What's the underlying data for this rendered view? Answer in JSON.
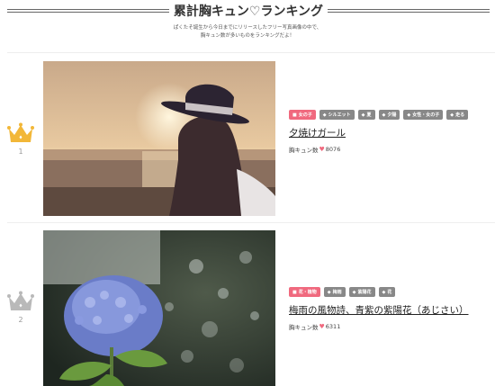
{
  "page": {
    "title": "累計胸キュン♡ランキング",
    "subtitle_line1": "ぱくたそ誕生から今日までにリリースしたフリー写真画像の中で、",
    "subtitle_line2": "胸キュン数が多いものをランキングだよ！"
  },
  "entries": [
    {
      "rank": "1",
      "crown_color": "#f2b738",
      "tags": [
        {
          "label": "女の子",
          "kind": "category"
        },
        {
          "label": "シルエット",
          "kind": "tag"
        },
        {
          "label": "夏",
          "kind": "tag"
        },
        {
          "label": "夕陽",
          "kind": "tag"
        },
        {
          "label": "女性・女の子",
          "kind": "tag"
        },
        {
          "label": "走る",
          "kind": "tag"
        }
      ],
      "title": "夕焼けガール",
      "count_label": "胸キュン数",
      "count": "8076"
    },
    {
      "rank": "2",
      "crown_color": "#b9b9b9",
      "tags": [
        {
          "label": "花・植物",
          "kind": "category"
        },
        {
          "label": "梅雨",
          "kind": "tag"
        },
        {
          "label": "紫陽花",
          "kind": "tag"
        },
        {
          "label": "花",
          "kind": "tag"
        }
      ],
      "title": "梅雨の風物詩、青紫の紫陽花（あじさい）",
      "count_label": "胸キュン数",
      "count": "6311"
    }
  ],
  "icons": {
    "crown": "crown-icon",
    "folder": "folder-icon",
    "tag": "tag-icon",
    "heart": "heart-icon"
  },
  "colors": {
    "accent": "#f0697e",
    "tag_bg": "#888888",
    "gold": "#f2b738",
    "silver": "#b9b9b9"
  }
}
